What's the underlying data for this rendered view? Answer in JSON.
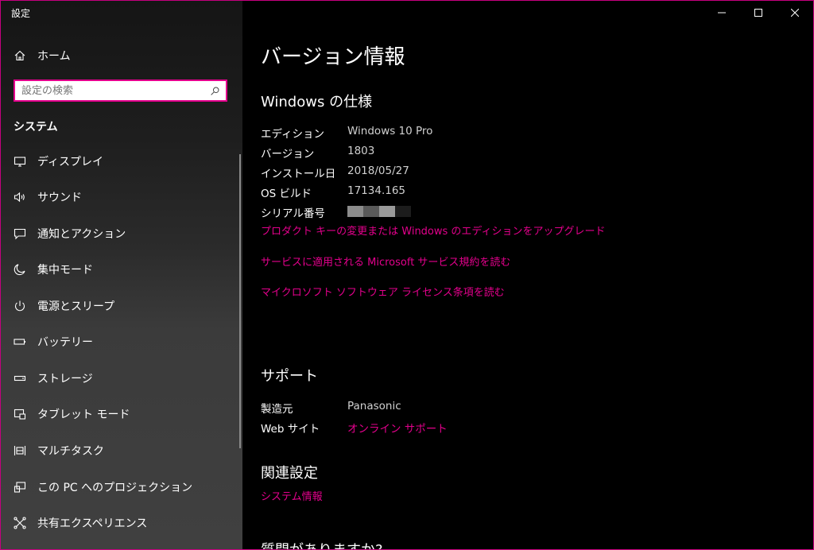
{
  "window": {
    "title": "設定"
  },
  "sidebar": {
    "home_label": "ホーム",
    "search_placeholder": "設定の検索",
    "section_label": "システム",
    "items": [
      {
        "label": "ディスプレイ",
        "icon": "display-icon"
      },
      {
        "label": "サウンド",
        "icon": "sound-icon"
      },
      {
        "label": "通知とアクション",
        "icon": "notification-icon"
      },
      {
        "label": "集中モード",
        "icon": "moon-icon"
      },
      {
        "label": "電源とスリープ",
        "icon": "power-icon"
      },
      {
        "label": "バッテリー",
        "icon": "battery-icon"
      },
      {
        "label": "ストレージ",
        "icon": "storage-icon"
      },
      {
        "label": "タブレット モード",
        "icon": "tablet-icon"
      },
      {
        "label": "マルチタスク",
        "icon": "multitask-icon"
      },
      {
        "label": "この PC へのプロジェクション",
        "icon": "projection-icon"
      },
      {
        "label": "共有エクスペリエンス",
        "icon": "shared-icon"
      }
    ]
  },
  "main": {
    "page_title": "バージョン情報",
    "spec": {
      "heading": "Windows の仕様",
      "rows": [
        {
          "key": "エディション",
          "value": "Windows 10 Pro"
        },
        {
          "key": "バージョン",
          "value": "1803"
        },
        {
          "key": "インストール日",
          "value": "2018/05/27"
        },
        {
          "key": "OS ビルド",
          "value": "17134.165"
        },
        {
          "key": "シリアル番号",
          "value": ""
        }
      ],
      "links": [
        "プロダクト キーの変更または Windows のエディションをアップグレード",
        "サービスに適用される Microsoft サービス規約を読む",
        "マイクロソフト ソフトウェア ライセンス条項を読む"
      ]
    },
    "support": {
      "heading": "サポート",
      "manufacturer_key": "製造元",
      "manufacturer_value": "Panasonic",
      "website_key": "Web サイト",
      "website_link": "オンライン サポート"
    },
    "related": {
      "heading": "関連設定",
      "link": "システム情報"
    },
    "question_heading": "質問がありますか?"
  },
  "colors": {
    "accent": "#e3008c",
    "border": "#c5007f"
  }
}
